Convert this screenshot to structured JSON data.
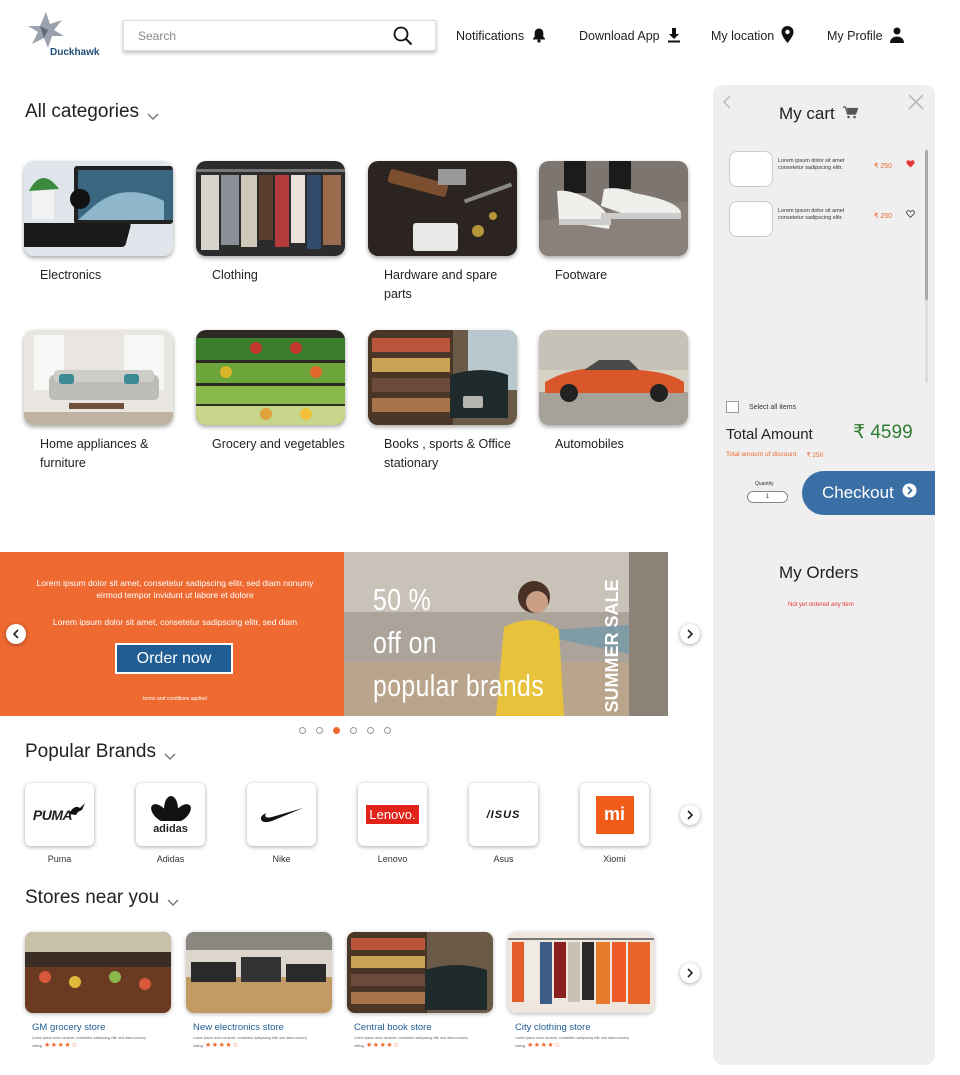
{
  "header": {
    "logo_text": "Duckhawk",
    "search_placeholder": "Search",
    "nav": {
      "notifications": "Notifications",
      "download_app": "Download App",
      "my_location": "My location",
      "my_profile": "My Profile"
    }
  },
  "categories": {
    "title": "All categories",
    "items": [
      {
        "label": "Electronics"
      },
      {
        "label": "Clothing"
      },
      {
        "label": "Hardware and spare parts"
      },
      {
        "label": "Footware"
      },
      {
        "label": "Home appliances & furniture"
      },
      {
        "label": "Grocery and vegetables"
      },
      {
        "label": "Books , sports & Office stationary"
      },
      {
        "label": "Automobiles"
      }
    ]
  },
  "banner": {
    "text1": "Lorem ipsum dolor sit amet, consetetur sadipscing elitr, sed diam nonumy eirmod tempor invidunt ut labore et dolore",
    "text2": "Lorem ipsum dolor sit amet, consetetur sadipscing elitr, sed diam",
    "order_button": "Order now",
    "terms": "terms and conditions applied",
    "promo_line1": "50 %",
    "promo_line2": "off on",
    "promo_line3": "popular brands",
    "side_text": "SUMMER SALE",
    "active_slide": 3,
    "slide_count": 6
  },
  "brands": {
    "title": "Popular Brands",
    "items": [
      {
        "label": "Puma",
        "logo": "PUMA"
      },
      {
        "label": "Adidas",
        "logo": "adidas"
      },
      {
        "label": "Nike",
        "logo": "nike-swoosh"
      },
      {
        "label": "Lenovo",
        "logo": "Lenovo."
      },
      {
        "label": "Asus",
        "logo": "/ISUS"
      },
      {
        "label": "Xiomi",
        "logo": "mi"
      }
    ]
  },
  "stores": {
    "title": "Stores near you",
    "items": [
      {
        "name": "GM grocery store",
        "desc": "Lorem ipsum dolor sit amet, consetetur sadipscing elitr, sed diam nonumy",
        "rating_label": "rating",
        "stars": "★★★★☆"
      },
      {
        "name": "New electronics store",
        "desc": "Lorem ipsum dolor sit amet, consetetur sadipscing elitr, sed diam nonumy",
        "rating_label": "rating",
        "stars": "★★★★☆"
      },
      {
        "name": "Central book store",
        "desc": "Lorem ipsum dolor sit amet, consetetur sadipscing elitr, sed diam nonumy",
        "rating_label": "rating",
        "stars": "★★★★☆"
      },
      {
        "name": "City clothing store",
        "desc": "Lorem ipsum dolor sit amet, consetetur sadipscing elitr, sed diam nonumy",
        "rating_label": "rating",
        "stars": "★★★★☆"
      }
    ]
  },
  "cart": {
    "title": "My cart",
    "items": [
      {
        "desc": "Lorem ipsum dolor sit amet consetetur sadipscing elitr.",
        "price": "₹ 250",
        "favorited": true
      },
      {
        "desc": "Lorem ipsum dolor sit amet consetetur sadipscing elitr.",
        "price": "₹ 250",
        "favorited": false
      }
    ],
    "select_all": "Select all items",
    "total_label": "Total Amount",
    "total_value": "₹ 4599",
    "discount_label": "Total amount of discount",
    "discount_value": "₹ 250",
    "quantity_label": "Quantity",
    "quantity_value": "1",
    "checkout": "Checkout",
    "orders_title": "My Orders",
    "orders_empty": "Not yet ordered any item"
  },
  "colors": {
    "accent_orange": "#ee6a31",
    "brand_blue": "#1f5d94",
    "checkout_blue": "#3a6fa5",
    "total_green": "#2e7d32",
    "panel_gray": "#efefef"
  },
  "icons": [
    "search-icon",
    "bell-icon",
    "download-icon",
    "location-pin-icon",
    "person-icon",
    "chevron-down-icon",
    "cart-icon",
    "close-icon",
    "heart-icon",
    "chevron-right-icon",
    "chevron-left-icon"
  ]
}
